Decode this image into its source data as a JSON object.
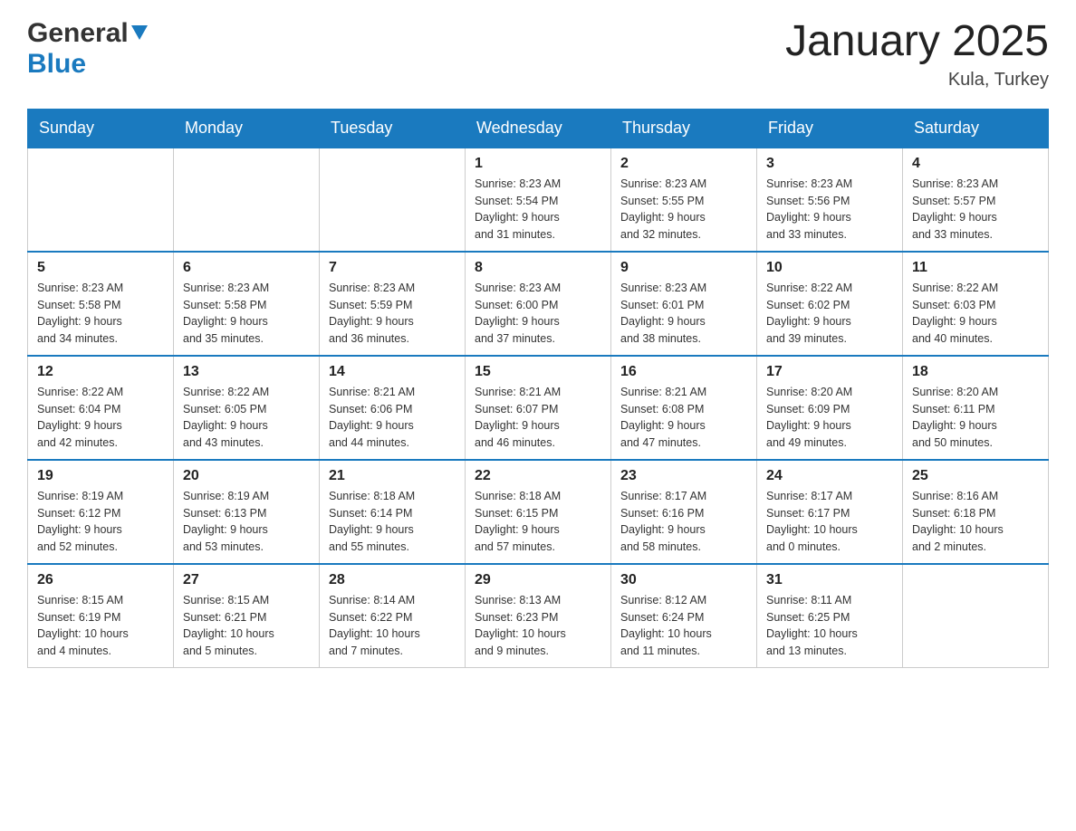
{
  "header": {
    "logo_general": "General",
    "logo_blue": "Blue",
    "month_title": "January 2025",
    "location": "Kula, Turkey"
  },
  "days_of_week": [
    "Sunday",
    "Monday",
    "Tuesday",
    "Wednesday",
    "Thursday",
    "Friday",
    "Saturday"
  ],
  "weeks": [
    [
      {
        "day": "",
        "info": ""
      },
      {
        "day": "",
        "info": ""
      },
      {
        "day": "",
        "info": ""
      },
      {
        "day": "1",
        "info": "Sunrise: 8:23 AM\nSunset: 5:54 PM\nDaylight: 9 hours\nand 31 minutes."
      },
      {
        "day": "2",
        "info": "Sunrise: 8:23 AM\nSunset: 5:55 PM\nDaylight: 9 hours\nand 32 minutes."
      },
      {
        "day": "3",
        "info": "Sunrise: 8:23 AM\nSunset: 5:56 PM\nDaylight: 9 hours\nand 33 minutes."
      },
      {
        "day": "4",
        "info": "Sunrise: 8:23 AM\nSunset: 5:57 PM\nDaylight: 9 hours\nand 33 minutes."
      }
    ],
    [
      {
        "day": "5",
        "info": "Sunrise: 8:23 AM\nSunset: 5:58 PM\nDaylight: 9 hours\nand 34 minutes."
      },
      {
        "day": "6",
        "info": "Sunrise: 8:23 AM\nSunset: 5:58 PM\nDaylight: 9 hours\nand 35 minutes."
      },
      {
        "day": "7",
        "info": "Sunrise: 8:23 AM\nSunset: 5:59 PM\nDaylight: 9 hours\nand 36 minutes."
      },
      {
        "day": "8",
        "info": "Sunrise: 8:23 AM\nSunset: 6:00 PM\nDaylight: 9 hours\nand 37 minutes."
      },
      {
        "day": "9",
        "info": "Sunrise: 8:23 AM\nSunset: 6:01 PM\nDaylight: 9 hours\nand 38 minutes."
      },
      {
        "day": "10",
        "info": "Sunrise: 8:22 AM\nSunset: 6:02 PM\nDaylight: 9 hours\nand 39 minutes."
      },
      {
        "day": "11",
        "info": "Sunrise: 8:22 AM\nSunset: 6:03 PM\nDaylight: 9 hours\nand 40 minutes."
      }
    ],
    [
      {
        "day": "12",
        "info": "Sunrise: 8:22 AM\nSunset: 6:04 PM\nDaylight: 9 hours\nand 42 minutes."
      },
      {
        "day": "13",
        "info": "Sunrise: 8:22 AM\nSunset: 6:05 PM\nDaylight: 9 hours\nand 43 minutes."
      },
      {
        "day": "14",
        "info": "Sunrise: 8:21 AM\nSunset: 6:06 PM\nDaylight: 9 hours\nand 44 minutes."
      },
      {
        "day": "15",
        "info": "Sunrise: 8:21 AM\nSunset: 6:07 PM\nDaylight: 9 hours\nand 46 minutes."
      },
      {
        "day": "16",
        "info": "Sunrise: 8:21 AM\nSunset: 6:08 PM\nDaylight: 9 hours\nand 47 minutes."
      },
      {
        "day": "17",
        "info": "Sunrise: 8:20 AM\nSunset: 6:09 PM\nDaylight: 9 hours\nand 49 minutes."
      },
      {
        "day": "18",
        "info": "Sunrise: 8:20 AM\nSunset: 6:11 PM\nDaylight: 9 hours\nand 50 minutes."
      }
    ],
    [
      {
        "day": "19",
        "info": "Sunrise: 8:19 AM\nSunset: 6:12 PM\nDaylight: 9 hours\nand 52 minutes."
      },
      {
        "day": "20",
        "info": "Sunrise: 8:19 AM\nSunset: 6:13 PM\nDaylight: 9 hours\nand 53 minutes."
      },
      {
        "day": "21",
        "info": "Sunrise: 8:18 AM\nSunset: 6:14 PM\nDaylight: 9 hours\nand 55 minutes."
      },
      {
        "day": "22",
        "info": "Sunrise: 8:18 AM\nSunset: 6:15 PM\nDaylight: 9 hours\nand 57 minutes."
      },
      {
        "day": "23",
        "info": "Sunrise: 8:17 AM\nSunset: 6:16 PM\nDaylight: 9 hours\nand 58 minutes."
      },
      {
        "day": "24",
        "info": "Sunrise: 8:17 AM\nSunset: 6:17 PM\nDaylight: 10 hours\nand 0 minutes."
      },
      {
        "day": "25",
        "info": "Sunrise: 8:16 AM\nSunset: 6:18 PM\nDaylight: 10 hours\nand 2 minutes."
      }
    ],
    [
      {
        "day": "26",
        "info": "Sunrise: 8:15 AM\nSunset: 6:19 PM\nDaylight: 10 hours\nand 4 minutes."
      },
      {
        "day": "27",
        "info": "Sunrise: 8:15 AM\nSunset: 6:21 PM\nDaylight: 10 hours\nand 5 minutes."
      },
      {
        "day": "28",
        "info": "Sunrise: 8:14 AM\nSunset: 6:22 PM\nDaylight: 10 hours\nand 7 minutes."
      },
      {
        "day": "29",
        "info": "Sunrise: 8:13 AM\nSunset: 6:23 PM\nDaylight: 10 hours\nand 9 minutes."
      },
      {
        "day": "30",
        "info": "Sunrise: 8:12 AM\nSunset: 6:24 PM\nDaylight: 10 hours\nand 11 minutes."
      },
      {
        "day": "31",
        "info": "Sunrise: 8:11 AM\nSunset: 6:25 PM\nDaylight: 10 hours\nand 13 minutes."
      },
      {
        "day": "",
        "info": ""
      }
    ]
  ]
}
